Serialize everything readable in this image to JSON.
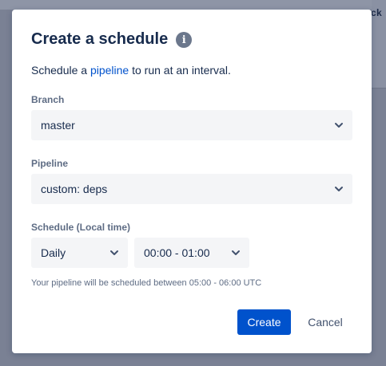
{
  "background": {
    "partial_text": "ck"
  },
  "dialog": {
    "title": "Create a schedule",
    "info_icon": "info-icon",
    "description_prefix": "Schedule a ",
    "description_link": "pipeline",
    "description_suffix": " to run at an interval."
  },
  "branch": {
    "label": "Branch",
    "value": "master"
  },
  "pipeline": {
    "label": "Pipeline",
    "value": "custom: deps"
  },
  "schedule": {
    "label": "Schedule (Local time)",
    "interval_value": "Daily",
    "time_value": "00:00 - 01:00",
    "hint": "Your pipeline will be scheduled between 05:00 - 06:00 UTC"
  },
  "actions": {
    "create_label": "Create",
    "cancel_label": "Cancel"
  },
  "colors": {
    "primary": "#0052cc",
    "link": "#0052cc",
    "text": "#172b4d",
    "muted": "#5e6c84",
    "field_bg": "#f4f5f7",
    "overlay": "#7a8194"
  }
}
